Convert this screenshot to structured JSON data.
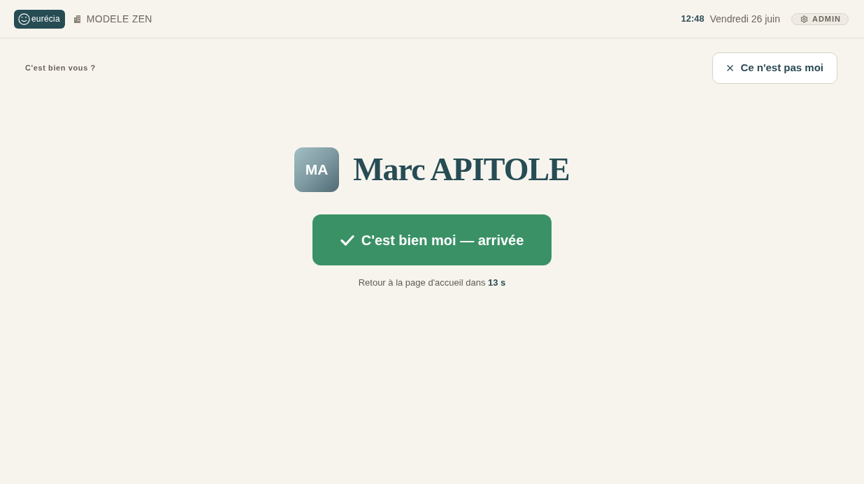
{
  "header": {
    "logo_text": "eurécia",
    "site": "MODELE ZEN",
    "time": "12:48",
    "date": "Vendredi 26 juin",
    "role": "ADMIN"
  },
  "prompt": "C'est bien vous ?",
  "dismiss_button": "Ce n'est pas moi",
  "person": {
    "initials": "MA",
    "name": "Marc APITOLE"
  },
  "confirm_button": "C'est bien moi — arrivée",
  "countdown": "Retour à la page d'accueil dans **13 s**"
}
